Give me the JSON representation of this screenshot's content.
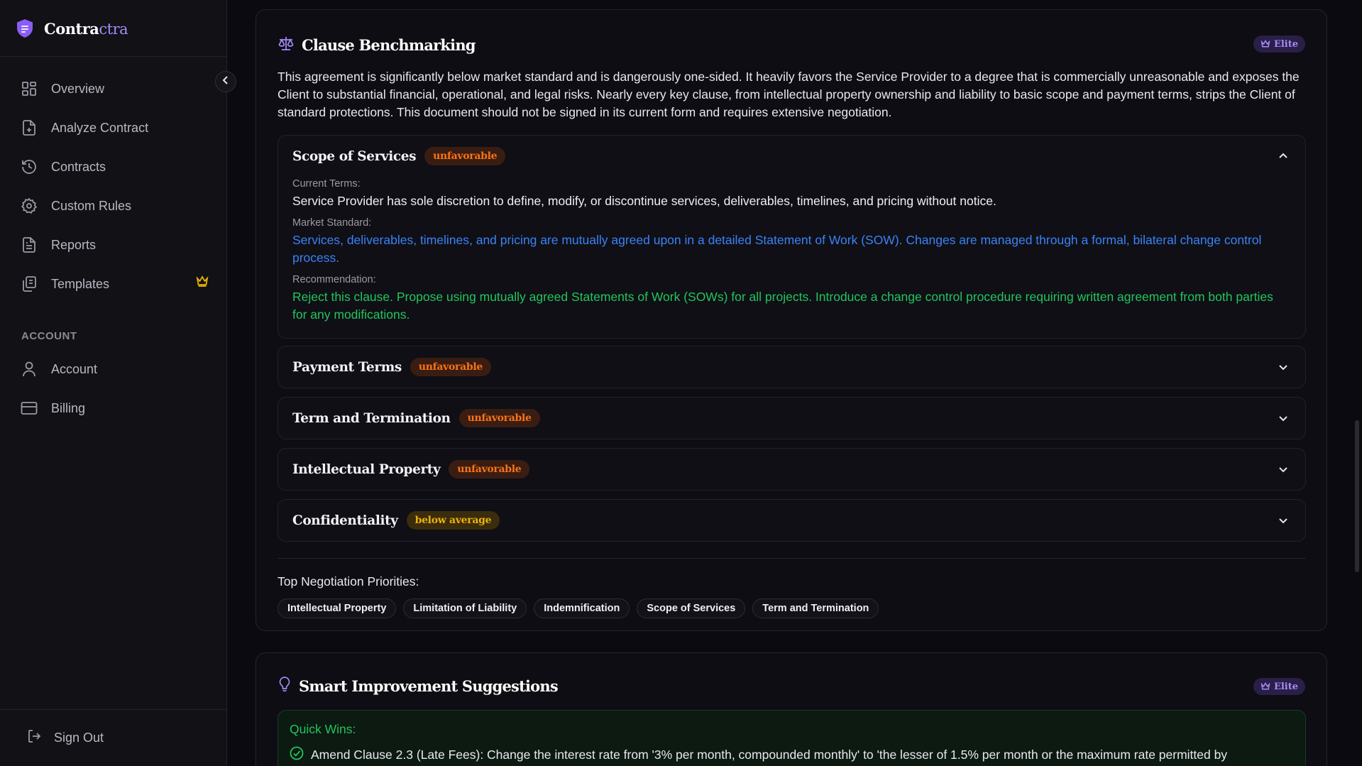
{
  "app": {
    "brand_main": "Contra",
    "brand_accent": "ctra"
  },
  "colors": {
    "accent": "#a78bfa",
    "unfavorable": "#f97316",
    "below_average": "#eab308",
    "market": "#3b82f6",
    "recommendation": "#22c55e"
  },
  "sidebar": {
    "items": [
      {
        "label": "Overview",
        "icon": "grid-icon"
      },
      {
        "label": "Analyze Contract",
        "icon": "file-plus-icon"
      },
      {
        "label": "Contracts",
        "icon": "history-icon"
      },
      {
        "label": "Custom Rules",
        "icon": "gear-icon"
      },
      {
        "label": "Reports",
        "icon": "document-icon"
      },
      {
        "label": "Templates",
        "icon": "copy-icon",
        "badge_icon": "crown-icon"
      }
    ],
    "account_label": "ACCOUNT",
    "account_items": [
      {
        "label": "Account",
        "icon": "user-icon"
      },
      {
        "label": "Billing",
        "icon": "credit-card-icon"
      }
    ],
    "signout": "Sign Out"
  },
  "benchmark": {
    "title": "Clause Benchmarking",
    "elite": "Elite",
    "summary": "This agreement is significantly below market standard and is dangerously one-sided. It heavily favors the Service Provider to a degree that is commercially unreasonable and exposes the Client to substantial financial, operational, and legal risks. Nearly every key clause, from intellectual property ownership and liability to basic scope and payment terms, strips the Client of standard protections. This document should not be signed in its current form and requires extensive negotiation.",
    "clauses": [
      {
        "title": "Scope of Services",
        "status": "unfavorable",
        "expanded": true,
        "current_label": "Current Terms:",
        "current": "Service Provider has sole discretion to define, modify, or discontinue services, deliverables, timelines, and pricing without notice.",
        "market_label": "Market Standard:",
        "market": "Services, deliverables, timelines, and pricing are mutually agreed upon in a detailed Statement of Work (SOW). Changes are managed through a formal, bilateral change control process.",
        "rec_label": "Recommendation:",
        "rec": "Reject this clause. Propose using mutually agreed Statements of Work (SOWs) for all projects. Introduce a change control procedure requiring written agreement from both parties for any modifications."
      },
      {
        "title": "Payment Terms",
        "status": "unfavorable",
        "expanded": false
      },
      {
        "title": "Term and Termination",
        "status": "unfavorable",
        "expanded": false
      },
      {
        "title": "Intellectual Property",
        "status": "unfavorable",
        "expanded": false
      },
      {
        "title": "Confidentiality",
        "status": "below average",
        "expanded": false
      }
    ],
    "priorities_label": "Top Negotiation Priorities:",
    "priorities": [
      "Intellectual Property",
      "Limitation of Liability",
      "Indemnification",
      "Scope of Services",
      "Term and Termination"
    ]
  },
  "suggestions": {
    "title": "Smart Improvement Suggestions",
    "elite": "Elite",
    "quick_wins_label": "Quick Wins:",
    "quick_wins": [
      "Amend Clause 2.3 (Late Fees): Change the interest rate from '3% per month, compounded monthly' to 'the lesser of 1.5% per month or the maximum rate permitted by"
    ]
  }
}
